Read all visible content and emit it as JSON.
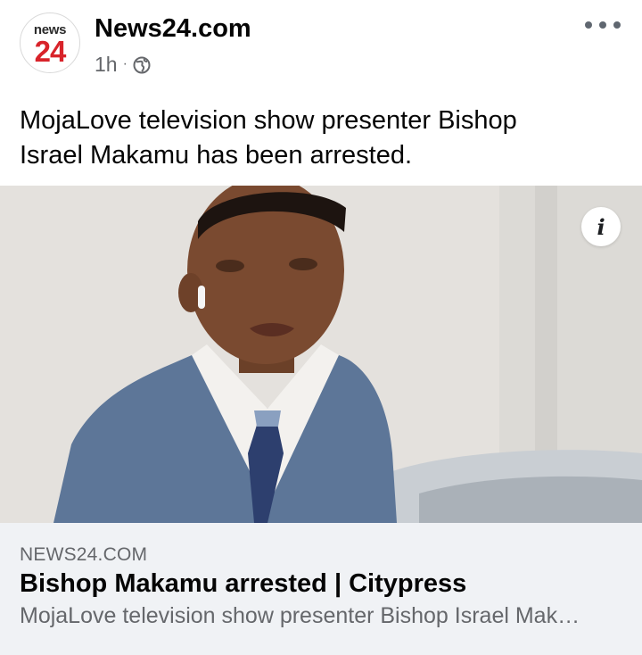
{
  "post": {
    "page_name": "News24.com",
    "timestamp": "1h",
    "separator": "·",
    "audience_icon": "globe-icon",
    "avatar": {
      "small_text": "news",
      "big_text": "24",
      "accent": "#d8232a"
    },
    "text_line1": "MojaLove television show presenter Bishop",
    "text_line2": "Israel Makamu has been arrested.",
    "image": {
      "subject": "photo-of-man-in-blue-suit",
      "info_icon": "info-icon",
      "info_label": "i"
    },
    "link": {
      "domain": "NEWS24.COM",
      "title": "Bishop Makamu arrested | Citypress",
      "description": "MojaLove television show presenter Bishop Israel Mak…"
    }
  }
}
